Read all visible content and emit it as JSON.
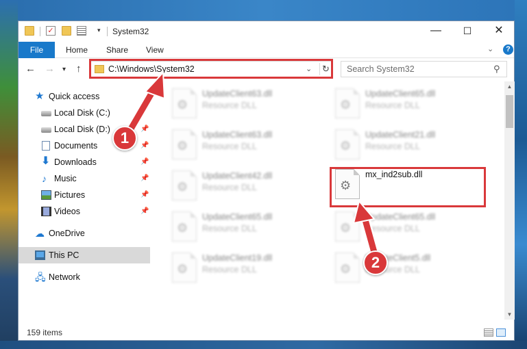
{
  "window": {
    "title": "System32",
    "controls": {
      "minimize": "—",
      "maximize": "☐",
      "close": "✕"
    }
  },
  "ribbon": {
    "tabs": [
      "File",
      "Home",
      "Share",
      "View"
    ]
  },
  "navigation": {
    "address": "C:\\Windows\\System32",
    "search_placeholder": "Search System32"
  },
  "sidebar": {
    "items": [
      {
        "label": "Quick access",
        "icon": "star-icon",
        "pinned": false
      },
      {
        "label": "Local Disk (C:)",
        "icon": "drive-icon",
        "pinned": false
      },
      {
        "label": "Local Disk (D:)",
        "icon": "drive-icon",
        "pinned": true
      },
      {
        "label": "Documents",
        "icon": "documents-icon",
        "pinned": true
      },
      {
        "label": "Downloads",
        "icon": "downloads-icon",
        "pinned": true
      },
      {
        "label": "Music",
        "icon": "music-icon",
        "pinned": true
      },
      {
        "label": "Pictures",
        "icon": "pictures-icon",
        "pinned": true
      },
      {
        "label": "Videos",
        "icon": "videos-icon",
        "pinned": true
      },
      {
        "label": "OneDrive",
        "icon": "onedrive-icon",
        "pinned": false
      },
      {
        "label": "This PC",
        "icon": "this-pc-icon",
        "pinned": false,
        "selected": true
      },
      {
        "label": "Network",
        "icon": "network-icon",
        "pinned": false
      }
    ]
  },
  "files": {
    "left_column": [
      {
        "name": "UpdateClient63.dll",
        "type": "Resource DLL"
      },
      {
        "name": "UpdateClient63.dll",
        "type": "Resource DLL"
      },
      {
        "name": "UpdateClient42.dll",
        "type": "Resource DLL"
      },
      {
        "name": "UpdateClient65.dll",
        "type": "Resource DLL"
      },
      {
        "name": "UpdateClient19.dll",
        "type": "Resource DLL"
      }
    ],
    "right_column": [
      {
        "name": "UpdateClient65.dll",
        "type": "Resource DLL"
      },
      {
        "name": "UpdateClient21.dll",
        "type": "Resource DLL"
      },
      {
        "name": "mx_ind2sub.dll",
        "type": ""
      },
      {
        "name": "UpdateClient65.dll",
        "type": "Resource DLL"
      },
      {
        "name": "UpdateClient5.dll",
        "type": "Resource DLL"
      }
    ]
  },
  "status": {
    "item_count": "159 items"
  },
  "annotations": {
    "callout_1": "1",
    "callout_2": "2",
    "highlight_color": "#d9383a"
  },
  "colors": {
    "accent": "#1979ca",
    "selection": "#d9d9d9"
  }
}
